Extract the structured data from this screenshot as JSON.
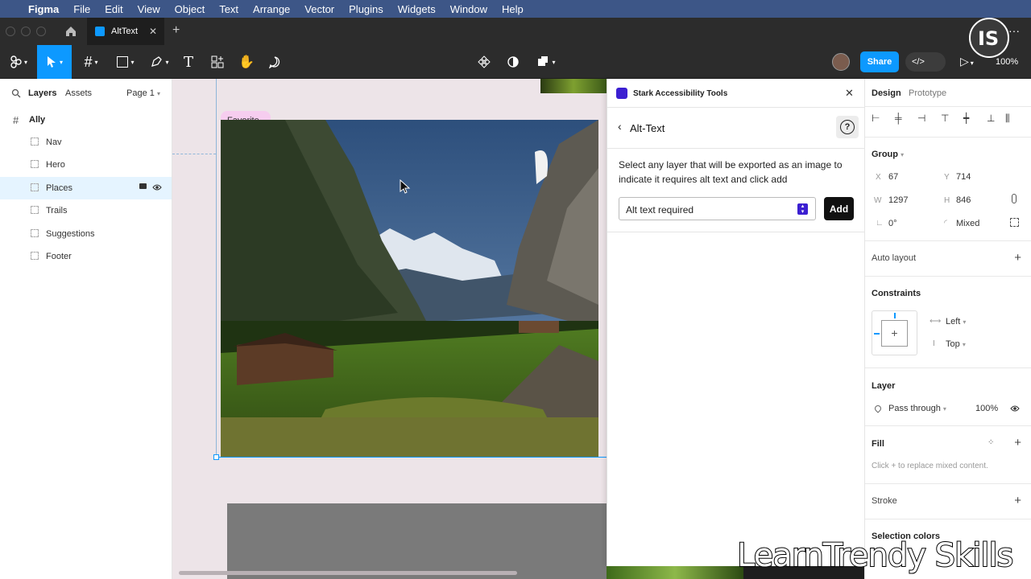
{
  "menubar": {
    "app": "Figma",
    "items": [
      "File",
      "Edit",
      "View",
      "Object",
      "Text",
      "Arrange",
      "Vector",
      "Plugins",
      "Widgets",
      "Window",
      "Help"
    ]
  },
  "tabs": {
    "active": "AltText"
  },
  "toolbar": {
    "share": "Share",
    "zoom": "100%"
  },
  "left_panel": {
    "tab_layers": "Layers",
    "tab_assets": "Assets",
    "page": "Page 1",
    "root": "Ally",
    "layers": [
      "Nav",
      "Hero",
      "Places",
      "Trails",
      "Suggestions",
      "Footer"
    ],
    "selected": "Places"
  },
  "canvas": {
    "badge": "Favorite"
  },
  "plugin": {
    "title": "Stark Accessibility Tools",
    "heading": "Alt-Text",
    "description": "Select any layer that will be exported as an image to indicate it requires alt text and click add",
    "select_value": "Alt text required",
    "add_label": "Add"
  },
  "right_panel": {
    "tab_design": "Design",
    "tab_prototype": "Prototype",
    "group_label": "Group",
    "x_label": "X",
    "x": "67",
    "y_label": "Y",
    "y": "714",
    "w_label": "W",
    "w": "1297",
    "h_label": "H",
    "h": "846",
    "rotation": "0°",
    "radius": "Mixed",
    "auto_layout": "Auto layout",
    "constraints": "Constraints",
    "constraint_h": "Left",
    "constraint_v": "Top",
    "layer": "Layer",
    "blend": "Pass through",
    "opacity": "100%",
    "fill": "Fill",
    "fill_note": "Click + to replace mixed content.",
    "stroke": "Stroke",
    "selection_colors": "Selection colors"
  },
  "watermark": "LearnTrendy Skills",
  "colors": {
    "accent": "#0d99ff",
    "menubar": "#3d5687",
    "plugin_brand": "#3b1fd1",
    "selection": "#e5f4ff"
  }
}
